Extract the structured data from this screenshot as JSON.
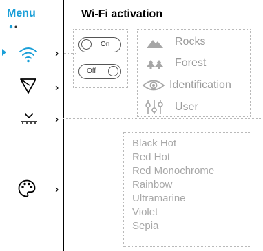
{
  "menu": {
    "title": "Menu"
  },
  "header": {
    "title": "Wi-Fi activation"
  },
  "nav": {
    "items": [
      {
        "icon": "wifi-icon",
        "chevron": "›",
        "selected": true
      },
      {
        "icon": "triangle-filter-icon",
        "chevron": "›"
      },
      {
        "icon": "horizon-chevron-icon",
        "chevron": "›"
      },
      {
        "icon": "palette-icon",
        "chevron": "›"
      }
    ]
  },
  "wifi_toggle": {
    "on_label": "On",
    "off_label": "Off"
  },
  "modes": [
    {
      "icon": "mountain-icon",
      "label": "Rocks"
    },
    {
      "icon": "trees-icon",
      "label": "Forest"
    },
    {
      "icon": "eye-icon",
      "label": "Identification"
    },
    {
      "icon": "sliders-icon",
      "label": "User"
    }
  ],
  "palettes": [
    "Black Hot",
    "Red Hot",
    "Red Monochrome",
    "Rainbow",
    "Ultramarine",
    "Violet",
    "Sepia"
  ],
  "colors": {
    "accent": "#1a9fd8",
    "muted_text": "#9a9a9a",
    "dotted": "#b9b9b9"
  }
}
